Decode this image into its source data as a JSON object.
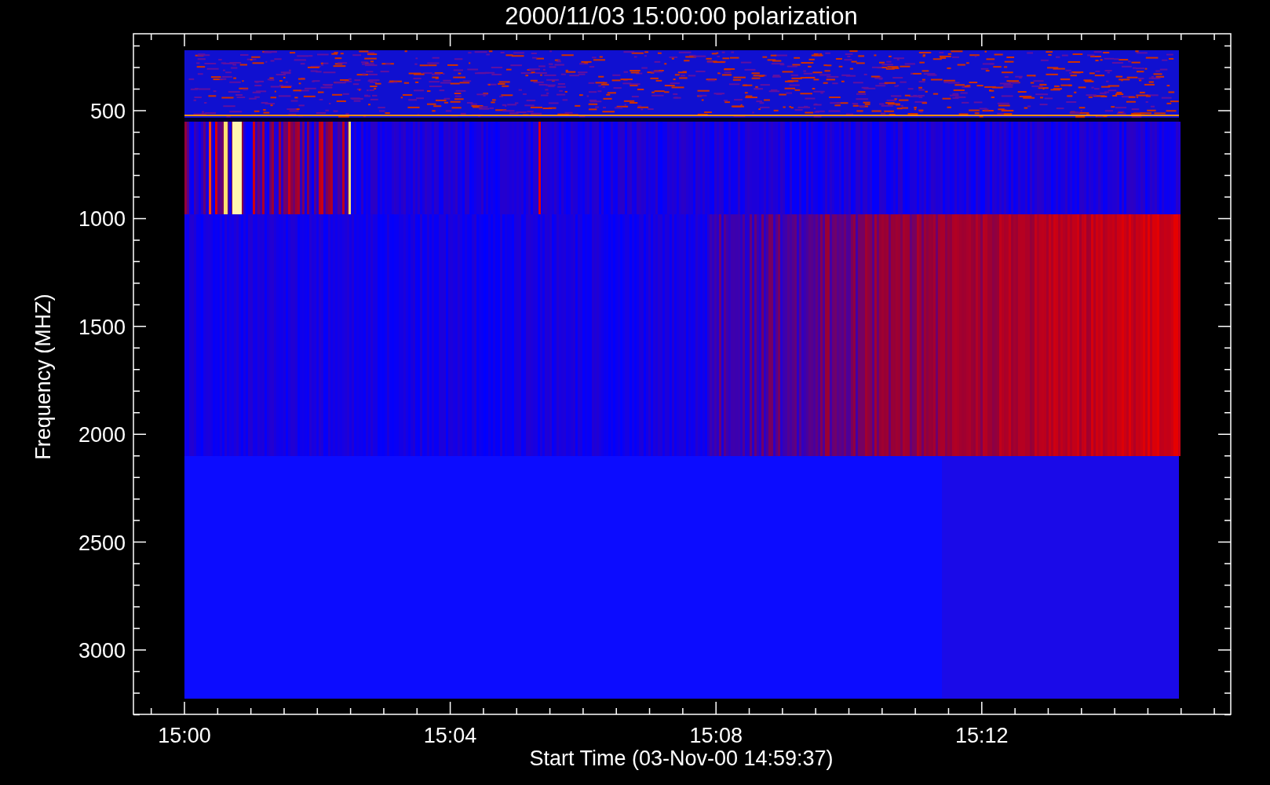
{
  "plot": {
    "title": "2000/11/03 15:00:00 polarization",
    "y_axis": {
      "label": "Frequency (MHZ)",
      "ticks": [
        "500",
        "1000",
        "1500",
        "2000",
        "2500",
        "3000"
      ]
    },
    "x_axis": {
      "label": "Start Time (03-Nov-00 14:59:37)",
      "ticks": [
        "15:00",
        "15:04",
        "15:08",
        "15:12"
      ]
    }
  }
}
